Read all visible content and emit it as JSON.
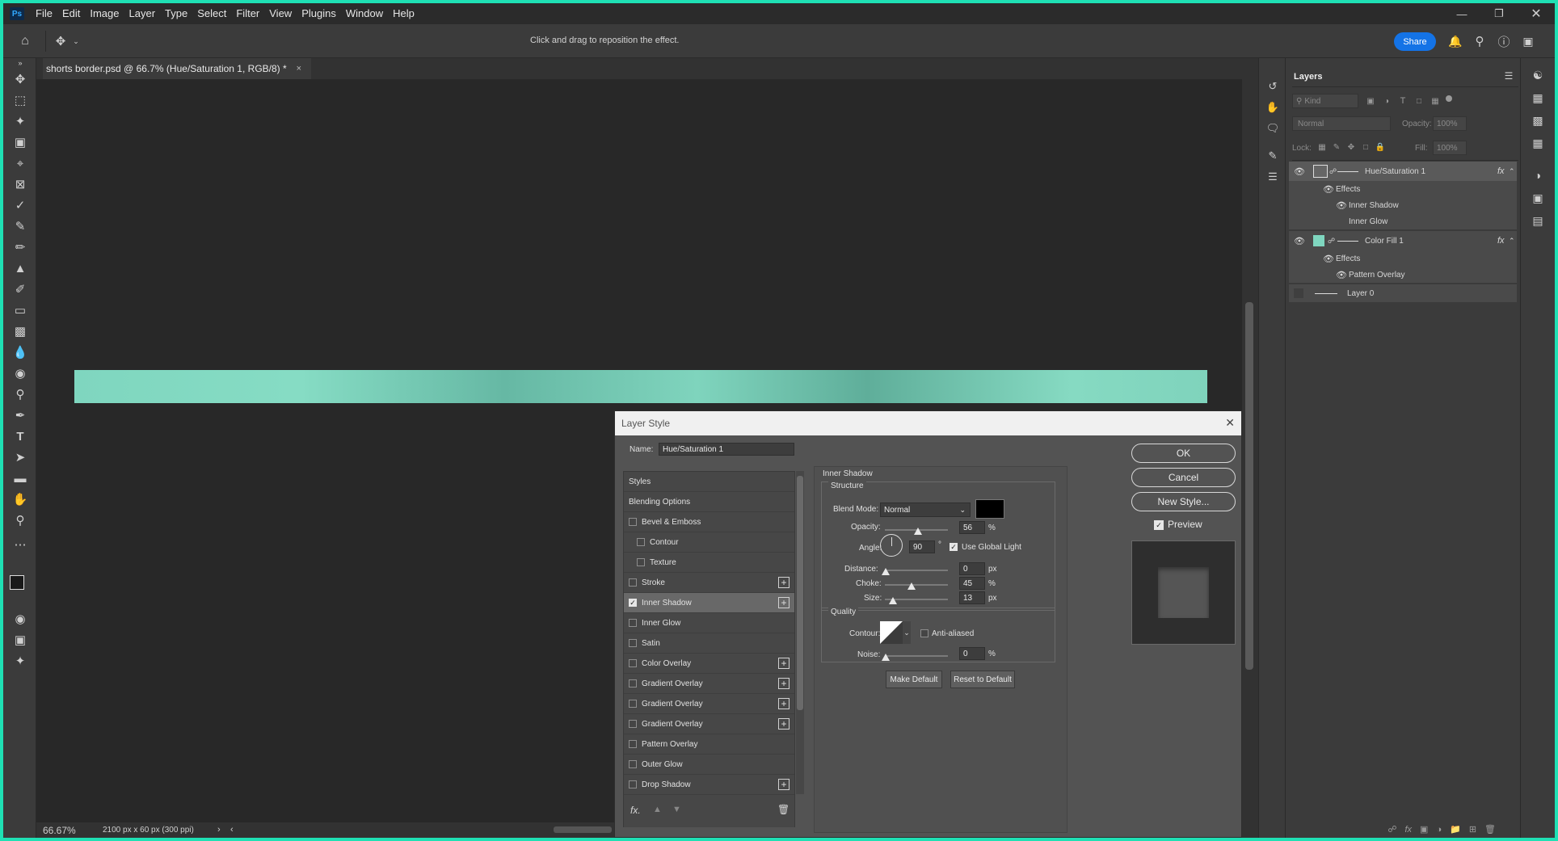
{
  "menubar": {
    "logo": "Ps",
    "items": [
      "File",
      "Edit",
      "Image",
      "Layer",
      "Type",
      "Select",
      "Filter",
      "View",
      "Plugins",
      "Window",
      "Help"
    ]
  },
  "options": {
    "hint": "Click and drag to reposition the effect.",
    "share": "Share"
  },
  "document": {
    "tab_title": "shorts border.psd @ 66.7% (Hue/Saturation 1, RGB/8) *",
    "zoom": "66.67%",
    "size_info": "2100 px x 60 px (300 ppi)"
  },
  "layers": {
    "title": "Layers",
    "search_placeholder": "Kind",
    "blend_mode": "Normal",
    "opacity_label": "Opacity:",
    "opacity_value": "100%",
    "lock_label": "Lock:",
    "fill_label": "Fill:",
    "fill_value": "100%",
    "items": [
      {
        "name": "Hue/Saturation 1",
        "effects": "Effects",
        "sub": [
          "Inner Shadow",
          "Inner Glow"
        ]
      },
      {
        "name": "Color Fill 1",
        "effects": "Effects",
        "sub": [
          "Pattern Overlay"
        ]
      },
      {
        "name": "Layer 0"
      }
    ]
  },
  "dialog": {
    "title": "Layer Style",
    "name_label": "Name:",
    "name_value": "Hue/Saturation 1",
    "styles": [
      "Styles",
      "Blending Options",
      "Bevel & Emboss",
      "Contour",
      "Texture",
      "Stroke",
      "Inner Shadow",
      "Inner Glow",
      "Satin",
      "Color Overlay",
      "Gradient Overlay",
      "Gradient Overlay",
      "Gradient Overlay",
      "Pattern Overlay",
      "Outer Glow",
      "Drop Shadow"
    ],
    "section_title": "Inner Shadow",
    "structure_label": "Structure",
    "blend_mode_label": "Blend Mode:",
    "blend_mode_value": "Normal",
    "opacity_label": "Opacity:",
    "opacity_value": "56",
    "percent": "%",
    "angle_label": "Angle:",
    "angle_value": "90",
    "degree": "°",
    "global_light": "Use Global Light",
    "distance_label": "Distance:",
    "distance_value": "0",
    "choke_label": "Choke:",
    "choke_value": "45",
    "size_label": "Size:",
    "size_value": "13",
    "px": "px",
    "quality_label": "Quality",
    "contour_label": "Contour:",
    "anti_aliased": "Anti-aliased",
    "noise_label": "Noise:",
    "noise_value": "0",
    "make_default": "Make Default",
    "reset_default": "Reset to Default",
    "ok": "OK",
    "cancel": "Cancel",
    "new_style": "New Style...",
    "preview": "Preview",
    "fx": "fx."
  }
}
